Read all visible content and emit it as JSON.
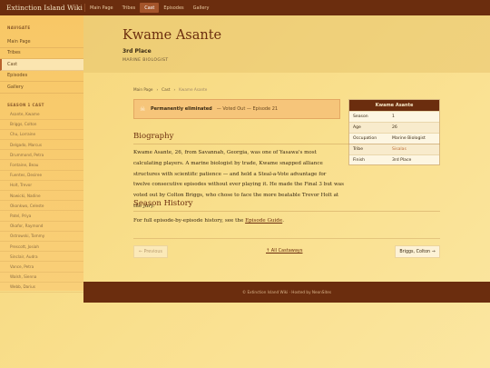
{
  "topbar": {
    "brand": "Extinction Island Wiki",
    "nav": [
      {
        "label": "Main Page",
        "active": false
      },
      {
        "label": "Tribes",
        "active": false
      },
      {
        "label": "Cast",
        "active": true
      },
      {
        "label": "Episodes",
        "active": false
      },
      {
        "label": "Gallery",
        "active": false
      }
    ]
  },
  "sidebar": {
    "nav_heading": "NAVIGATE",
    "nav_items": [
      {
        "label": "Main Page",
        "active": false
      },
      {
        "label": "Tribes",
        "active": false
      },
      {
        "label": "Cast",
        "active": true
      },
      {
        "label": "Episodes",
        "active": false
      },
      {
        "label": "Gallery",
        "active": false
      }
    ],
    "cast_heading": "SEASON 1 CAST",
    "cast_items": [
      "Asante, Kwame",
      "Briggs, Colton",
      "Chu, Lorraine",
      "Delgado, Marcus",
      "Drummond, Petra",
      "Fontaine, Beau",
      "Fuentes, Desiree",
      "Holt, Trevor",
      "Nowicki, Nadine",
      "Okonkwo, Celeste",
      "Patel, Priya",
      "Okafor, Raymond",
      "Ostrowski, Tammy",
      "Prescott, Josiah",
      "Sinclair, Audra",
      "Vance, Petra",
      "Walsh, Sienna",
      "Webb, Darius"
    ]
  },
  "header": {
    "title": "Kwame Asante",
    "placement": "3rd Place",
    "occupation": "MARINE BIOLOGIST"
  },
  "breadcrumb": [
    "Main Page",
    "›",
    "Cast",
    "›",
    "Kwame Asante"
  ],
  "elimination": {
    "icon": "skull-icon",
    "status": "Permanently eliminated",
    "detail": "— Voted Out — Episode 21"
  },
  "infobox": {
    "title": "Kwame Asante",
    "rows": [
      {
        "key": "Season",
        "value": "1"
      },
      {
        "key": "Age",
        "value": "26"
      },
      {
        "key": "Occupation",
        "value": "Marine Biologist"
      },
      {
        "key": "Tribe",
        "value": "Sisalas"
      },
      {
        "key": "Finish",
        "value": "3rd Place"
      }
    ]
  },
  "biography": {
    "heading": "Biography",
    "text": "Kwame Asante, 26, from Savannah, Georgia, was one of Yasawa's most calculating players. A marine biologist by trade, Kwame snapped alliance structures with scientific patience — and held a Steal-a-Vote advantage for twelve consecutive episodes without ever playing it. He made the Final 3 but was voted out by Colton Briggs, who chose to face the more beatable Trevor Holt at the jury."
  },
  "history": {
    "heading": "Season History",
    "prefix": "For full episode-by-episode history, see the ",
    "link": "Episode Guide",
    "suffix": "."
  },
  "pager": {
    "prev": "← Previous",
    "center": "↑ All Castaways",
    "next": "Briggs, Colton →"
  },
  "footer": "© Extinction Island Wiki · Hosted by NeonSites"
}
